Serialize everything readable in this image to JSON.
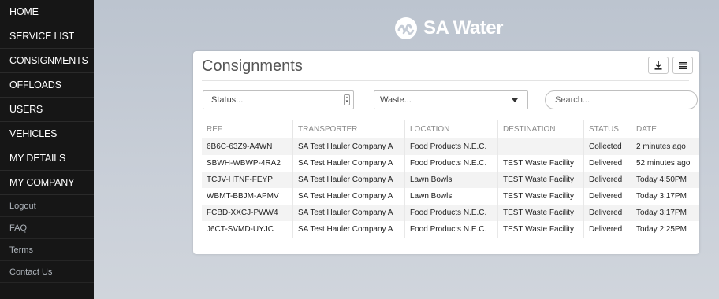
{
  "sidebar": {
    "main_items": [
      "HOME",
      "SERVICE LIST",
      "CONSIGNMENTS",
      "OFFLOADS",
      "USERS",
      "VEHICLES",
      "MY DETAILS",
      "MY COMPANY"
    ],
    "minor_items": [
      "Logout",
      "FAQ",
      "Terms",
      "Contact Us"
    ]
  },
  "brand": {
    "name": "SA Water",
    "logo_icon": "sa-water-wave-icon"
  },
  "panel": {
    "title": "Consignments",
    "download_icon": "download-icon",
    "menu_icon": "menu-icon"
  },
  "filters": {
    "status_placeholder": "Status...",
    "waste_placeholder": "Waste...",
    "search_placeholder": "Search..."
  },
  "table": {
    "headers": [
      "REF",
      "TRANSPORTER",
      "LOCATION",
      "DESTINATION",
      "STATUS",
      "DATE"
    ],
    "rows": [
      [
        "6B6C-63Z9-A4WN",
        "SA Test Hauler Company A",
        "Food Products N.E.C.",
        "",
        "Collected",
        "2 minutes ago"
      ],
      [
        "SBWH-WBWP-4RA2",
        "SA Test Hauler Company A",
        "Food Products N.E.C.",
        "TEST Waste Facility",
        "Delivered",
        "52 minutes ago"
      ],
      [
        "TCJV-HTNF-FEYP",
        "SA Test Hauler Company A",
        "Lawn Bowls",
        "TEST Waste Facility",
        "Delivered",
        "Today 4:50PM"
      ],
      [
        "WBMT-BBJM-APMV",
        "SA Test Hauler Company A",
        "Lawn Bowls",
        "TEST Waste Facility",
        "Delivered",
        "Today 3:17PM"
      ],
      [
        "FCBD-XXCJ-PWW4",
        "SA Test Hauler Company A",
        "Food Products N.E.C.",
        "TEST Waste Facility",
        "Delivered",
        "Today 3:17PM"
      ],
      [
        "J6CT-SVMD-UYJC",
        "SA Test Hauler Company A",
        "Food Products N.E.C.",
        "TEST Waste Facility",
        "Delivered",
        "Today 2:25PM"
      ]
    ]
  },
  "colors": {
    "sidebar_bg": "#161616",
    "content_bg": "#c5ccd6",
    "row_stripe": "#f3f3f3"
  }
}
